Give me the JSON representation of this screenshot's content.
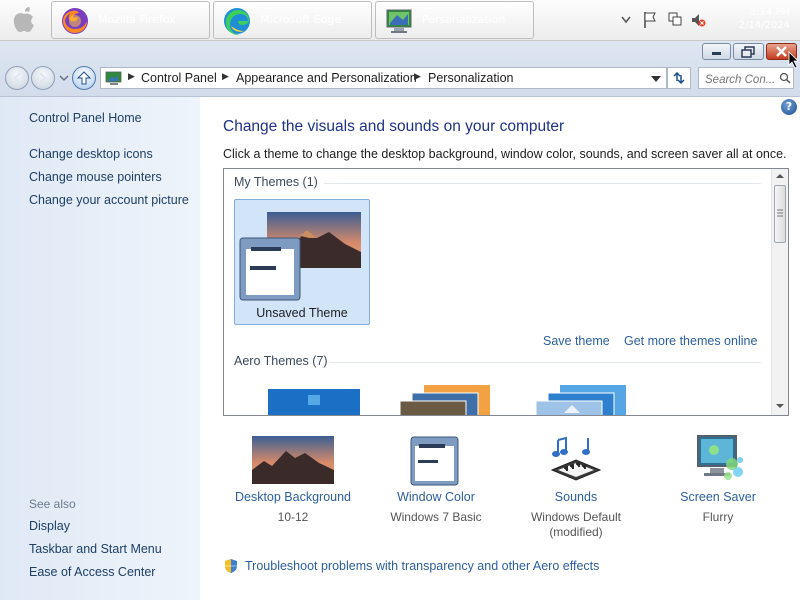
{
  "taskbar": {
    "apps": [
      {
        "icon": "firefox-icon",
        "label": "Mozilla Firefox"
      },
      {
        "icon": "edge-icon",
        "label": "Microsoft Edge"
      },
      {
        "icon": "control-panel-icon",
        "label": "Personalization"
      }
    ],
    "clock": {
      "time": "3:14 PM",
      "date": "2/14/2024"
    }
  },
  "address": {
    "crumbs": [
      "Control Panel",
      "Appearance and Personalization",
      "Personalization"
    ],
    "search_placeholder": "Search Con..."
  },
  "leftnav": {
    "home": "Control Panel Home",
    "links": [
      "Change desktop icons",
      "Change mouse pointers",
      "Change your account picture"
    ],
    "see_also_title": "See also",
    "see_also": [
      "Display",
      "Taskbar and Start Menu",
      "Ease of Access Center"
    ]
  },
  "main": {
    "heading": "Change the visuals and sounds on your computer",
    "subtext": "Click a theme to change the desktop background, window color, sounds, and screen saver all at once.",
    "my_themes_header": "My Themes (1)",
    "unsaved_theme": "Unsaved Theme",
    "save_theme": "Save theme",
    "get_more": "Get more themes online",
    "aero_header": "Aero Themes (7)"
  },
  "tools": [
    {
      "label": "Desktop Background",
      "sub": "10-12"
    },
    {
      "label": "Window Color",
      "sub": "Windows 7 Basic"
    },
    {
      "label": "Sounds",
      "sub": "Windows Default (modified)"
    },
    {
      "label": "Screen Saver",
      "sub": "Flurry"
    }
  ],
  "troubleshoot": "Troubleshoot problems with transparency and other Aero effects",
  "colors": {
    "link": "#2c5f9e",
    "heading": "#1e3287",
    "close_button": "#c23d20"
  }
}
